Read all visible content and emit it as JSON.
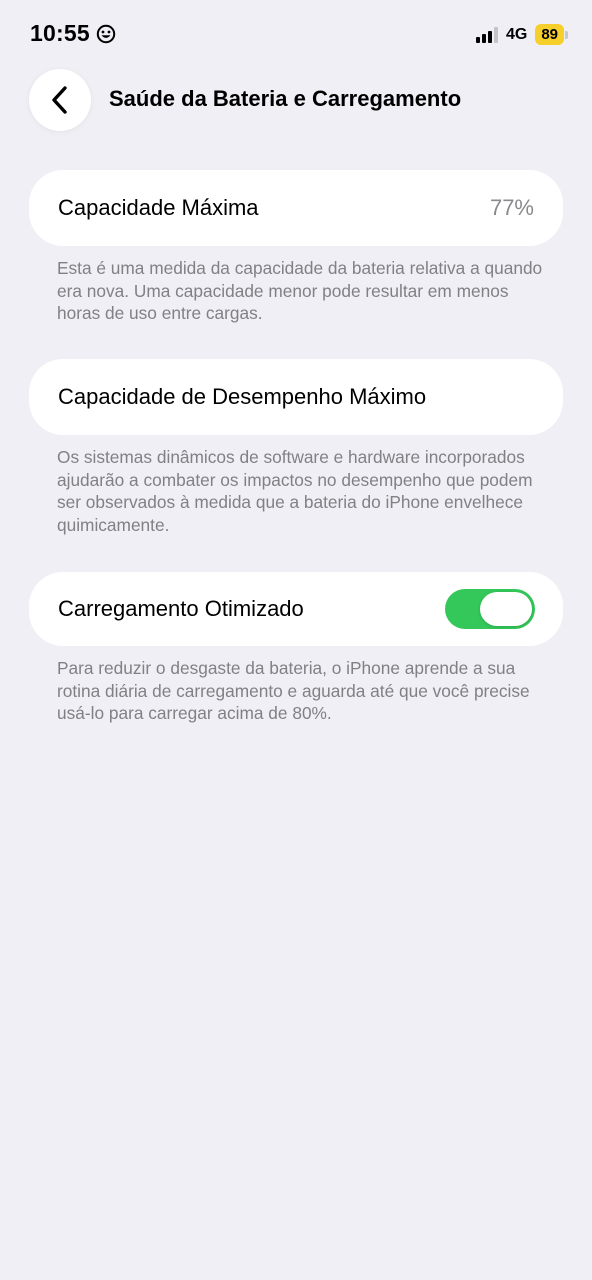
{
  "status_bar": {
    "time": "10:55",
    "network": "4G",
    "battery_level": "89",
    "signal_bars_active": 3,
    "signal_bars_total": 4,
    "battery_color": "#f7cf2b"
  },
  "nav": {
    "title": "Saúde da Bateria e Carregamento",
    "back_icon": "chevron-left-icon"
  },
  "capacity": {
    "label": "Capacidade Máxima",
    "value": "77%",
    "footnote": "Esta é uma medida da capacidade da bateria relativa a quando era nova. Uma capacidade menor pode resultar em menos horas de uso entre cargas."
  },
  "performance": {
    "label": "Capacidade de Desempenho Máximo",
    "footnote": "Os sistemas dinâmicos de software e hardware incorporados ajudarão a combater os impactos no desempenho que podem ser observados à medida que a bateria do iPhone envelhece quimicamente."
  },
  "optimized_charging": {
    "label": "Carregamento Otimizado",
    "enabled": true,
    "toggle_color": "#34c759",
    "footnote": "Para reduzir o desgaste da bateria, o iPhone aprende a sua rotina diária de carregamento e aguarda até que você precise usá-lo para carregar acima de 80%."
  }
}
